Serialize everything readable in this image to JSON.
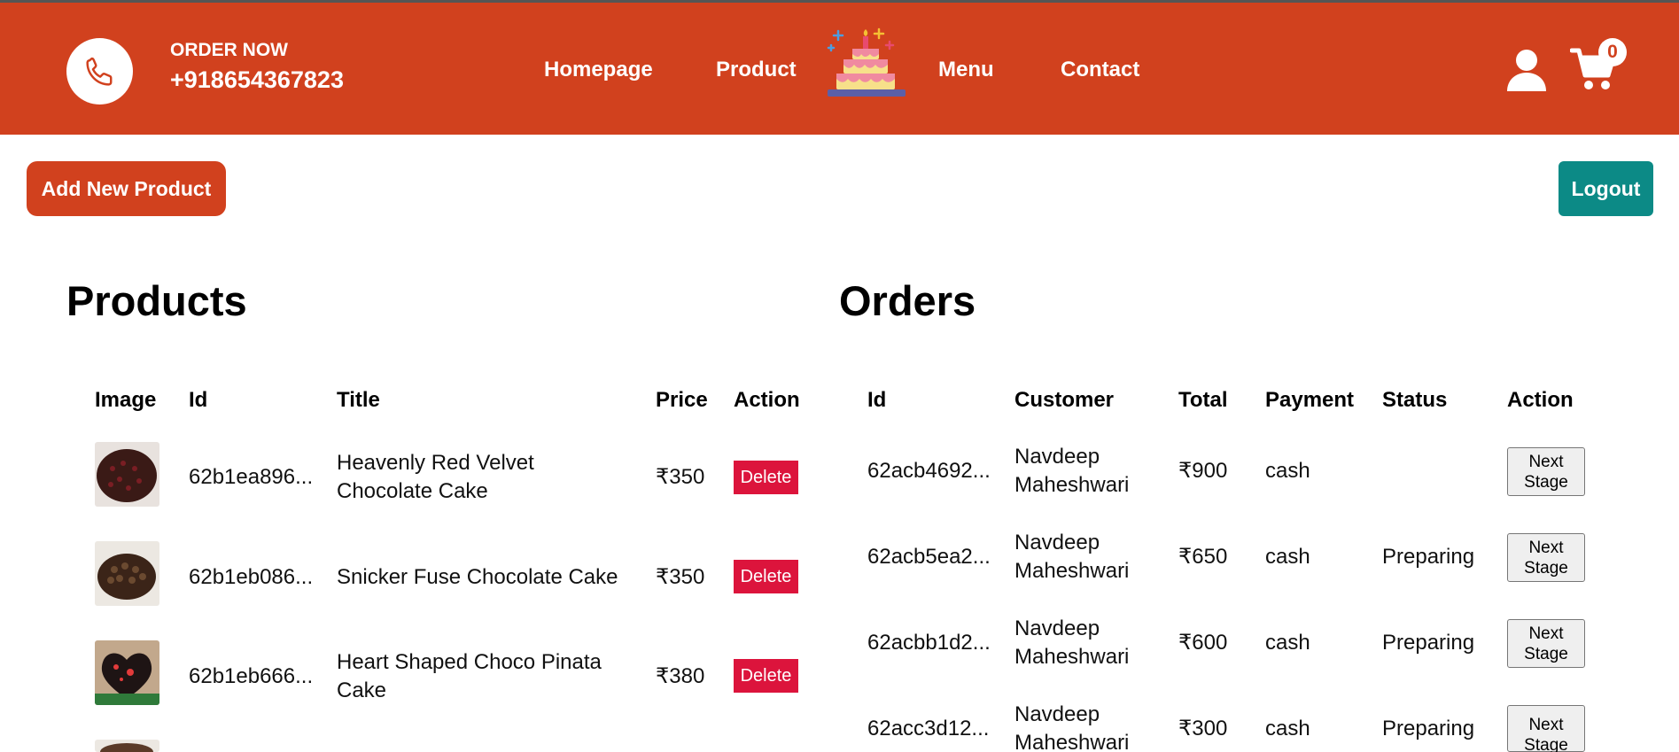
{
  "header": {
    "order_now": "ORDER NOW",
    "phone": "+918654367823",
    "nav": [
      "Homepage",
      "Product",
      "Menu",
      "Contact"
    ],
    "cart_count": "0"
  },
  "actions": {
    "add_product": "Add New Product",
    "logout": "Logout"
  },
  "products": {
    "title": "Products",
    "headers": [
      "Image",
      "Id",
      "Title",
      "Price",
      "Action"
    ],
    "rows": [
      {
        "id": "62b1ea896...",
        "title_line1": "Heavenly Red Velvet",
        "title_line2": "Chocolate Cake",
        "price": "₹350",
        "action": "Delete"
      },
      {
        "id": "62b1eb086...",
        "title_line1": "Snicker Fuse Chocolate Cake",
        "title_line2": "",
        "price": "₹350",
        "action": "Delete"
      },
      {
        "id": "62b1eb666...",
        "title_line1": "Heart Shaped Choco Pinata",
        "title_line2": "Cake",
        "price": "₹380",
        "action": "Delete"
      }
    ]
  },
  "orders": {
    "title": "Orders",
    "headers": [
      "Id",
      "Customer",
      "Total",
      "Payment",
      "Status",
      "Action"
    ],
    "rows": [
      {
        "id": "62acb4692...",
        "customer_line1": "Navdeep",
        "customer_line2": "Maheshwari",
        "total": "₹900",
        "payment": "cash",
        "status": "",
        "action_line1": "Next",
        "action_line2": "Stage"
      },
      {
        "id": "62acb5ea2...",
        "customer_line1": "Navdeep",
        "customer_line2": "Maheshwari",
        "total": "₹650",
        "payment": "cash",
        "status": "Preparing",
        "action_line1": "Next",
        "action_line2": "Stage"
      },
      {
        "id": "62acbb1d2...",
        "customer_line1": "Navdeep",
        "customer_line2": "Maheshwari",
        "total": "₹600",
        "payment": "cash",
        "status": "Preparing",
        "action_line1": "Next",
        "action_line2": "Stage"
      },
      {
        "id": "62acc3d12...",
        "customer_line1": "Navdeep",
        "customer_line2": "Maheshwari",
        "total": "₹300",
        "payment": "cash",
        "status": "Preparing",
        "action_line1": "Next",
        "action_line2": "Stage"
      }
    ]
  },
  "colors": {
    "brand": "#d1411e",
    "logout": "#0c8a86",
    "delete": "#dc143c"
  }
}
